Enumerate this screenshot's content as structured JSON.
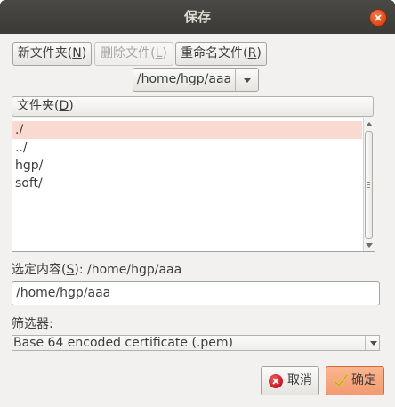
{
  "window": {
    "title": "保存"
  },
  "toolbar": {
    "new_folder": {
      "pre": "新文件夹(",
      "key": "N",
      "post": ")"
    },
    "delete_file": {
      "pre": "删除文件(",
      "key": "L",
      "post": ")"
    },
    "rename_file": {
      "pre": "重命名文件(",
      "key": "R",
      "post": ")"
    }
  },
  "path_combo": {
    "value": "/home/hgp/aaa"
  },
  "folder_list": {
    "header": {
      "pre": "文件夹(",
      "key": "D",
      "post": ")"
    },
    "items": [
      "./",
      "../",
      "hgp/",
      "soft/"
    ],
    "selected_index": 0
  },
  "selection": {
    "label": {
      "pre": "选定内容(",
      "key": "S",
      "post": "): /home/hgp/aaa"
    },
    "value": "/home/hgp/aaa"
  },
  "filter": {
    "label": "筛选器:",
    "value": "Base 64 encoded certificate (.pem)"
  },
  "buttons": {
    "cancel": "取消",
    "ok": "确定"
  },
  "colors": {
    "titlebar": "#3c3b37",
    "selection_highlight": "#f9d9d0",
    "ok_button": "#f39a6f",
    "close_button": "#dd4814"
  }
}
